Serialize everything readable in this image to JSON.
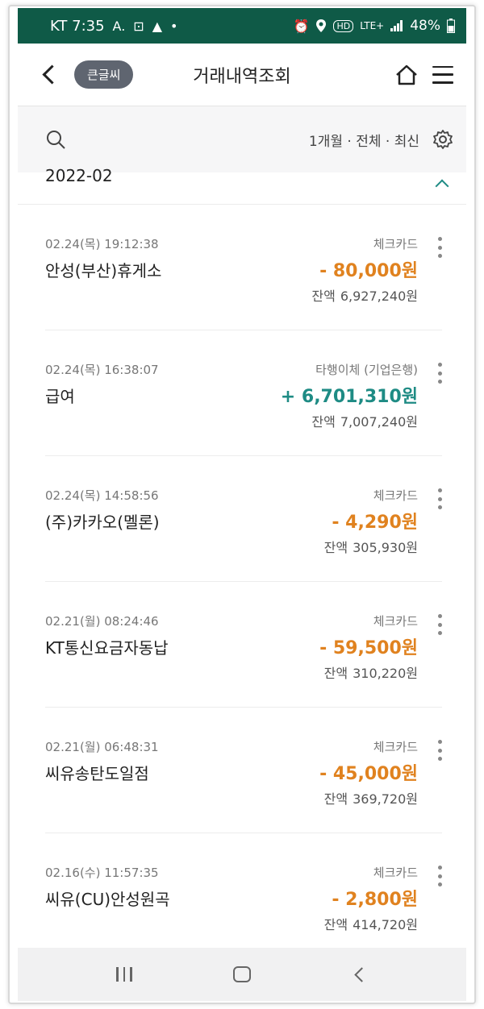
{
  "status_bar": {
    "carrier_time": "KT 7:35",
    "left_icons": [
      "A.",
      "⊡",
      "▲",
      "•"
    ],
    "battery": "48%",
    "network": "LTE+"
  },
  "header": {
    "title": "거래내역조회",
    "big_font_label": "큰글씨"
  },
  "filter": {
    "summary": "1개월 · 전체 · 최신"
  },
  "month": {
    "label": "2022-02"
  },
  "colors": {
    "status_bar": "#0f5a47",
    "withdraw": "#e0821f",
    "deposit": "#1e8b84"
  },
  "transactions": [
    {
      "datetime": "02.24(목) 19:12:38",
      "name": "안성(부산)휴게소",
      "type": "체크카드",
      "amount": "- 80,000원",
      "direction": "withdraw",
      "balance_label": "잔액",
      "balance": "6,927,240원"
    },
    {
      "datetime": "02.24(목) 16:38:07",
      "name": "급여",
      "type": "타행이체 (기업은행)",
      "amount": "+ 6,701,310원",
      "direction": "deposit",
      "balance_label": "잔액",
      "balance": "7,007,240원"
    },
    {
      "datetime": "02.24(목) 14:58:56",
      "name": "(주)카카오(멜론)",
      "type": "체크카드",
      "amount": "- 4,290원",
      "direction": "withdraw",
      "balance_label": "잔액",
      "balance": "305,930원"
    },
    {
      "datetime": "02.21(월) 08:24:46",
      "name": "KT통신요금자동납",
      "type": "체크카드",
      "amount": "- 59,500원",
      "direction": "withdraw",
      "balance_label": "잔액",
      "balance": "310,220원"
    },
    {
      "datetime": "02.21(월) 06:48:31",
      "name": "씨유송탄도일점",
      "type": "체크카드",
      "amount": "- 45,000원",
      "direction": "withdraw",
      "balance_label": "잔액",
      "balance": "369,720원"
    },
    {
      "datetime": "02.16(수) 11:57:35",
      "name": "씨유(CU)안성원곡",
      "type": "체크카드",
      "amount": "- 2,800원",
      "direction": "withdraw",
      "balance_label": "잔액",
      "balance": "414,720원"
    }
  ]
}
